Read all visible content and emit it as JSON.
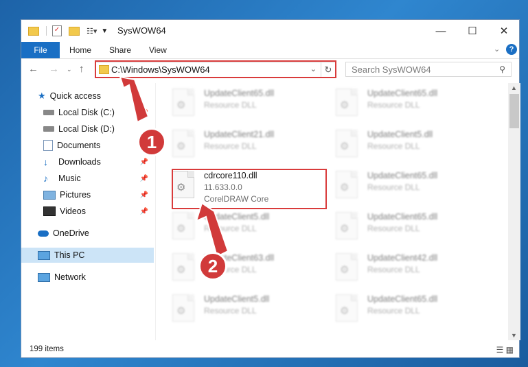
{
  "window": {
    "title": "SysWOW64"
  },
  "window_controls": {
    "minimize": "—",
    "maximize": "☐",
    "close": "✕"
  },
  "ribbon": {
    "tabs": [
      "File",
      "Home",
      "Share",
      "View"
    ]
  },
  "address": {
    "path": "C:\\Windows\\SysWOW64"
  },
  "search": {
    "placeholder": "Search SysWOW64"
  },
  "sidebar": {
    "items": [
      {
        "label": "Quick access",
        "icon": "star-icon"
      },
      {
        "label": "Local Disk (C:)",
        "icon": "drive-icon"
      },
      {
        "label": "Local Disk (D:)",
        "icon": "drive-icon"
      },
      {
        "label": "Documents",
        "icon": "documents-icon"
      },
      {
        "label": "Downloads",
        "icon": "downloads-icon"
      },
      {
        "label": "Music",
        "icon": "music-icon"
      },
      {
        "label": "Pictures",
        "icon": "pictures-icon"
      },
      {
        "label": "Videos",
        "icon": "videos-icon"
      },
      {
        "label": "OneDrive",
        "icon": "cloud-icon"
      },
      {
        "label": "This PC",
        "icon": "computer-icon"
      },
      {
        "label": "Network",
        "icon": "network-icon"
      }
    ]
  },
  "files": {
    "main": {
      "name": "cdrcore110.dll",
      "version": "11.633.0.0",
      "desc": "CorelDRAW Core"
    },
    "col1": [
      {
        "name": "UpdateClient65.dll",
        "desc": "Resource DLL"
      },
      {
        "name": "UpdateClient21.dll",
        "desc": "Resource DLL"
      },
      {
        "name": "UpdateClient5.dll",
        "desc": "Resource DLL"
      },
      {
        "name": "UpdateClient63.dll",
        "desc": "Resource DLL"
      },
      {
        "name": "UpdateClient5.dll",
        "desc": "Resource DLL"
      }
    ],
    "col2": [
      {
        "name": "UpdateClient65.dll",
        "desc": "Resource DLL"
      },
      {
        "name": "UpdateClient5.dll",
        "desc": "Resource DLL"
      },
      {
        "name": "UpdateClient65.dll",
        "desc": "Resource DLL"
      },
      {
        "name": "UpdateClient65.dll",
        "desc": "Resource DLL"
      },
      {
        "name": "UpdateClient42.dll",
        "desc": "Resource DLL"
      },
      {
        "name": "UpdateClient65.dll",
        "desc": "Resource DLL"
      }
    ]
  },
  "status": {
    "items": "199 items"
  },
  "annotations": {
    "badge1": "1",
    "badge2": "2"
  },
  "colors": {
    "accent": "#1a6fc4",
    "highlight": "#d93b3b",
    "selected": "#cce4f7"
  }
}
